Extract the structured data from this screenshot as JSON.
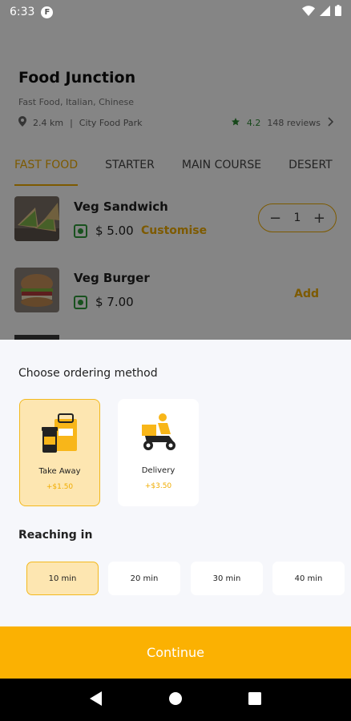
{
  "status_bar": {
    "time": "6:33",
    "app_badge": "F"
  },
  "restaurant": {
    "name": "Food Junction",
    "cuisine": "Fast Food, Italian, Chinese",
    "distance": "2.4 km",
    "location": "City Food Park",
    "rating": "4.2",
    "reviews": "148 reviews"
  },
  "tabs": [
    {
      "label": "FAST FOOD",
      "active": true
    },
    {
      "label": "STARTER",
      "active": false
    },
    {
      "label": "MAIN COURSE",
      "active": false
    },
    {
      "label": "DESERT",
      "active": false
    }
  ],
  "dishes": [
    {
      "name": "Veg Sandwich",
      "price": "$ 5.00",
      "customise_label": "Customise",
      "quantity": "1"
    },
    {
      "name": "Veg Burger",
      "price": "$ 7.00",
      "add_label": "Add"
    }
  ],
  "sheet": {
    "title": "Choose ordering method",
    "methods": [
      {
        "label": "Take Away",
        "fee": "+$1.50",
        "selected": true,
        "icon": "takeaway-bag-icon"
      },
      {
        "label": "Delivery",
        "fee": "+$3.50",
        "selected": false,
        "icon": "delivery-scooter-icon"
      }
    ],
    "reach_title": "Reaching in",
    "times": [
      {
        "label": "10 min",
        "selected": true
      },
      {
        "label": "20 min",
        "selected": false
      },
      {
        "label": "30 min",
        "selected": false
      },
      {
        "label": "40 min",
        "selected": false
      }
    ]
  },
  "continue_label": "Continue",
  "colors": {
    "accent": "#fbb102",
    "selected_bg": "#fde6b1",
    "veg_green": "#2e9c3b",
    "rating_green": "#2e8b34"
  }
}
